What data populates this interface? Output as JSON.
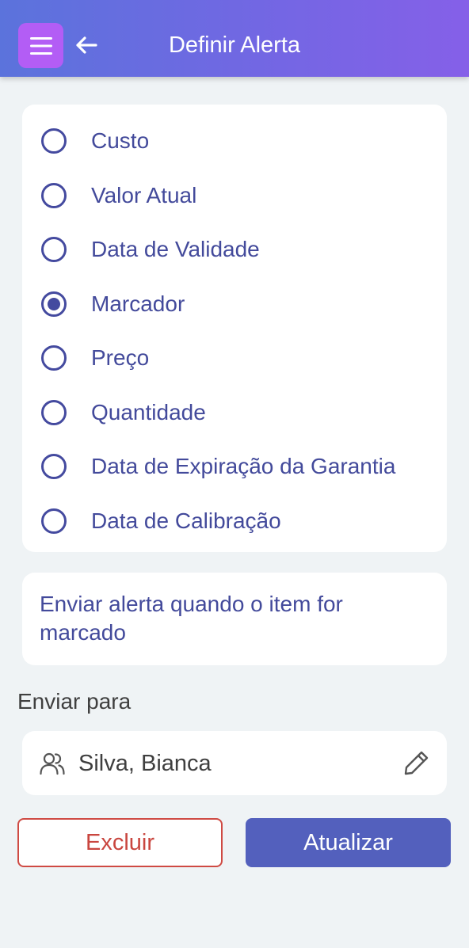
{
  "header": {
    "title": "Definir Alerta",
    "menu_icon": "hamburger-menu-icon",
    "back_icon": "arrow-left-icon"
  },
  "options": [
    {
      "label": "Custo",
      "selected": false
    },
    {
      "label": "Valor Atual",
      "selected": false
    },
    {
      "label": "Data de Validade",
      "selected": false
    },
    {
      "label": "Marcador",
      "selected": true
    },
    {
      "label": "Preço",
      "selected": false
    },
    {
      "label": "Quantidade",
      "selected": false
    },
    {
      "label": "Data de Expiração da Garantia",
      "selected": false
    },
    {
      "label": "Data de Calibração",
      "selected": false
    }
  ],
  "message": "Enviar alerta quando o item for marcado",
  "send_to": {
    "label": "Enviar para",
    "recipient": "Silva, Bianca",
    "recipient_icon": "users-icon",
    "edit_icon": "pencil-icon"
  },
  "actions": {
    "delete_label": "Excluir",
    "update_label": "Atualizar"
  },
  "colors": {
    "header_gradient_start": "#5b73dc",
    "header_gradient_end": "#8560e8",
    "menu_button": "#b35df5",
    "accent_text": "#434a9b",
    "primary_button": "#5360bd",
    "danger": "#cf4a43",
    "background": "#eff3f5"
  }
}
